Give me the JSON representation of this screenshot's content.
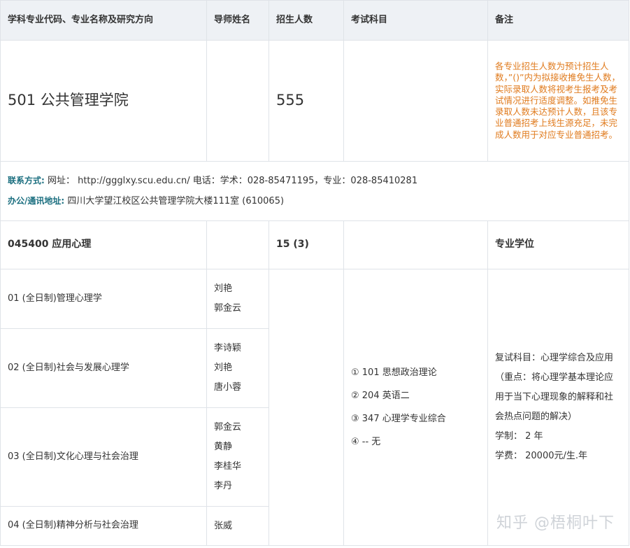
{
  "headers": {
    "col1": "学科专业代码、专业名称及研究方向",
    "col2": "导师姓名",
    "col3": "招生人数",
    "col4": "考试科目",
    "col5": "备注"
  },
  "college": {
    "name": "501 公共管理学院",
    "count": "555",
    "note": "各专业招生人数为预计招生人数，”()”内为拟接收推免生人数，实际录取人数将视考生报考及考试情况进行适度调整。如推免生录取人数未达预计人数，且该专业普通招考上线生源充足，未完成人数用于对应专业普通招考。"
  },
  "contact": {
    "label1": "联系方式:",
    "text1": " 网址： http://ggglxy.scu.edu.cn/ 电话：学术：028-85471195，专业：028-85410281",
    "label2": "办公/通讯地址:",
    "text2": " 四川大学望江校区公共管理学院大楼111室 (610065)"
  },
  "major": {
    "code_name": "045400 应用心理",
    "count": "15 (3)",
    "degree": "专业学位"
  },
  "directions": [
    {
      "name": "01 (全日制)管理心理学",
      "teachers": [
        "刘艳",
        "郭金云"
      ]
    },
    {
      "name": "02 (全日制)社会与发展心理学",
      "teachers": [
        "李诗颖",
        "刘艳",
        "唐小蓉"
      ]
    },
    {
      "name": "03 (全日制)文化心理与社会治理",
      "teachers": [
        "郭金云",
        "黄静",
        "李桂华",
        "李丹"
      ]
    },
    {
      "name": "04 (全日制)精神分析与社会治理",
      "teachers": [
        "张威"
      ]
    }
  ],
  "subjects": [
    "① 101 思想政治理论",
    "② 204 英语二",
    "③ 347 心理学专业综合",
    "④ -- 无"
  ],
  "remarks": {
    "retest": "复试科目：心理学综合及应用（重点：将心理学基本理论应用于当下心理现象的解释和社会热点问题的解决）",
    "duration": "学制： 2 年",
    "fee": "学费： 20000元/生.年"
  },
  "watermark": "知乎 @梧桐叶下"
}
